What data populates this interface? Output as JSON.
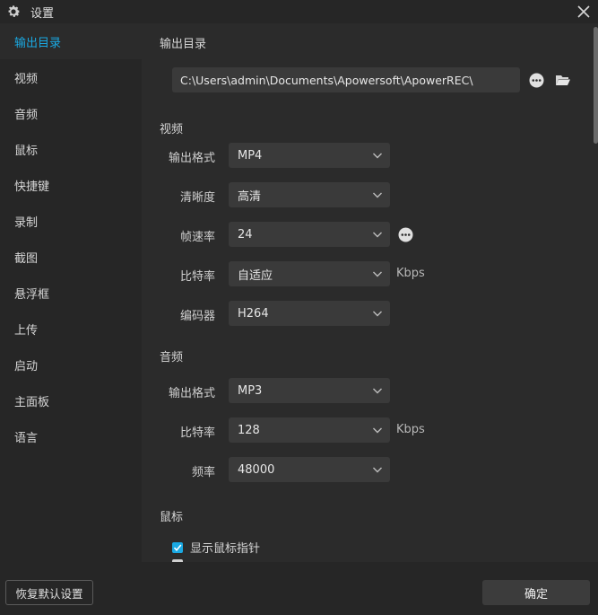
{
  "window": {
    "title": "设置",
    "icon": "gear-icon",
    "close_icon": "close-icon"
  },
  "sidebar": {
    "items": [
      {
        "label": "输出目录",
        "active": true
      },
      {
        "label": "视频"
      },
      {
        "label": "音频"
      },
      {
        "label": "鼠标"
      },
      {
        "label": "快捷键"
      },
      {
        "label": "录制"
      },
      {
        "label": "截图"
      },
      {
        "label": "悬浮框"
      },
      {
        "label": "上传"
      },
      {
        "label": "启动"
      },
      {
        "label": "主面板"
      },
      {
        "label": "语言"
      }
    ]
  },
  "output_dir": {
    "section_title": "输出目录",
    "path": "C:\\Users\\admin\\Documents\\Apowersoft\\ApowerREC\\",
    "more_icon": "more-icon",
    "folder_icon": "folder-open-icon"
  },
  "video": {
    "section_title": "视频",
    "format_label": "输出格式",
    "format_value": "MP4",
    "quality_label": "清晰度",
    "quality_value": "高清",
    "framerate_label": "帧速率",
    "framerate_value": "24",
    "bitrate_label": "比特率",
    "bitrate_value": "自适应",
    "bitrate_unit": "Kbps",
    "codec_label": "编码器",
    "codec_value": "H264"
  },
  "audio": {
    "section_title": "音频",
    "format_label": "输出格式",
    "format_value": "MP3",
    "bitrate_label": "比特率",
    "bitrate_value": "128",
    "bitrate_unit": "Kbps",
    "frequency_label": "频率",
    "frequency_value": "48000"
  },
  "mouse": {
    "section_title": "鼠标",
    "show_pointer_label": "显示鼠标指针",
    "show_pointer_checked": true
  },
  "footer": {
    "reset_label": "恢复默认设置",
    "ok_label": "确定"
  },
  "colors": {
    "accent": "#1aa9e3",
    "background": "#2b2b2b",
    "sidebar": "#262626",
    "field": "#3a3a3a"
  }
}
